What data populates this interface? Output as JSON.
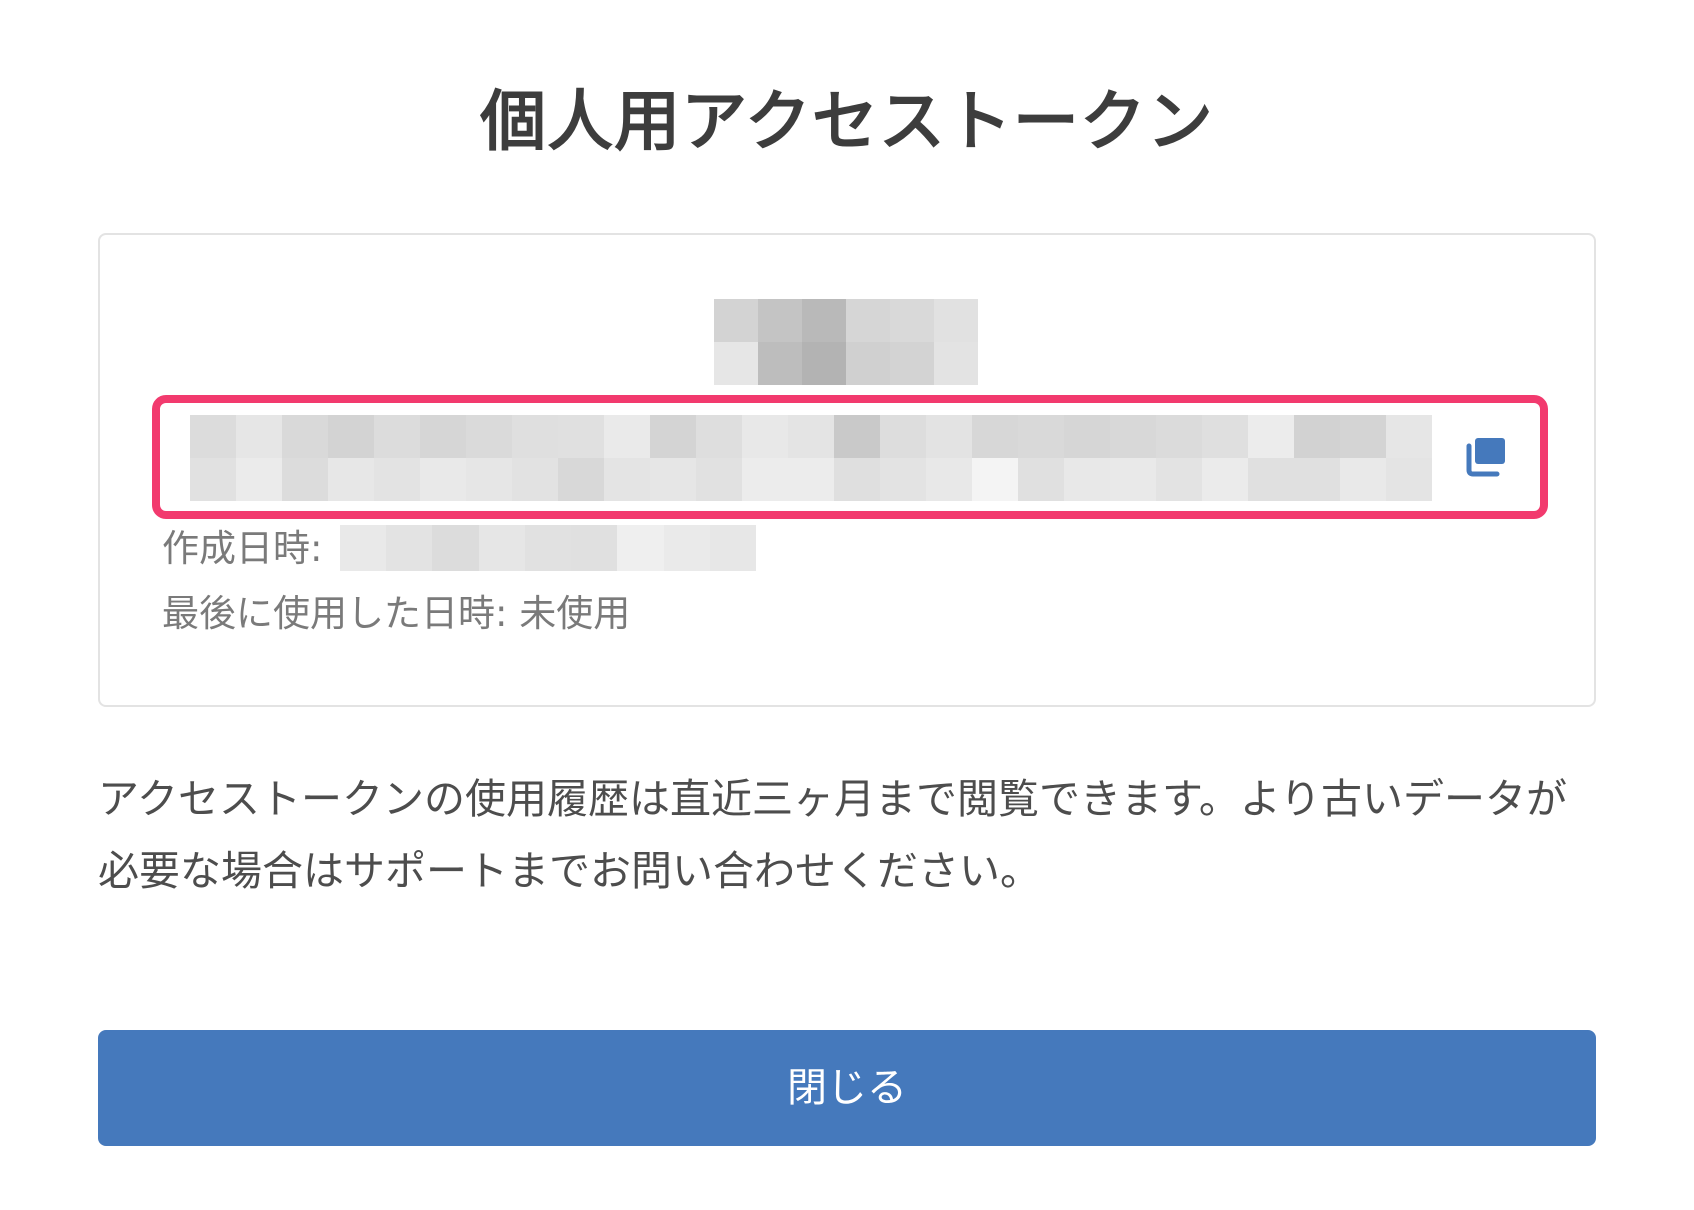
{
  "dialog": {
    "title": "個人用アクセストークン",
    "token": {
      "created_label": "作成日時:",
      "last_used_label": "最後に使用した日時: 未使用",
      "copy_icon": "copy-icon"
    },
    "notice": "アクセストークンの使用履歴は直近三ヶ月まで閲覧できます。より古いデータが必要な場合はサポートまでお問い合わせください。",
    "close_label": "閉じる"
  },
  "colors": {
    "highlight_border": "#f23a6e",
    "button_bg": "#4579bc",
    "copy_icon": "#4579bc"
  }
}
